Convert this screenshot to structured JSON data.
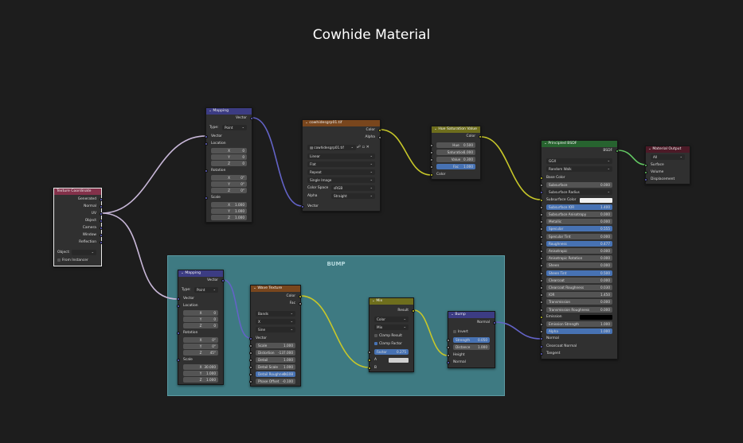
{
  "title": "Cowhide Material",
  "frame": {
    "label": "BUMP"
  },
  "texcoord": {
    "title": "Texture Coordinate",
    "outputs": [
      "Generated",
      "Normal",
      "UV",
      "Object",
      "Camera",
      "Window",
      "Reflection"
    ],
    "object_label": "Object:",
    "from_instancer": "From Instancer"
  },
  "mapping1": {
    "title": "Mapping",
    "out": "Vector",
    "type_label": "Type:",
    "type_value": "Point",
    "vector": "Vector",
    "location": "Location",
    "loc": [
      "0",
      "0",
      "0"
    ],
    "rotation": "Rotation",
    "rot": [
      "0°",
      "0°",
      "0°"
    ],
    "scale": "Scale",
    "scl": [
      "1.000",
      "1.000",
      "1.000"
    ],
    "axes": [
      "X",
      "Y",
      "Z"
    ]
  },
  "imgtex": {
    "title": "cowhidesgrp01.tif",
    "outputs": [
      "Color",
      "Alpha"
    ],
    "image_name": "cowhidesgrp01.tif",
    "interp": "Linear",
    "proj": "Flat",
    "ext": "Repeat",
    "source": "Single Image",
    "colorspace_label": "Color Space",
    "colorspace": "sRGB",
    "alpha_label": "Alpha",
    "alpha": "Straight",
    "vector": "Vector"
  },
  "hsv": {
    "title": "Hue Saturation Value",
    "out": "Color",
    "fields": [
      {
        "label": "Hue",
        "value": "0.500"
      },
      {
        "label": "Saturation",
        "value": "1.000"
      },
      {
        "label": "Value",
        "value": "0.300"
      },
      {
        "label": "Fac",
        "value": "1.000"
      }
    ],
    "color_in": "Color"
  },
  "principled": {
    "title": "Principled BSDF",
    "out": "BSDF",
    "dist": "GGX",
    "sss_method": "Random Walk",
    "rows": [
      {
        "label": "Base Color",
        "value": "",
        "kind": "text",
        "sock": "yellow"
      },
      {
        "label": "Subsurface",
        "value": "0.000",
        "kind": "field",
        "sock": "gray"
      },
      {
        "label": "Subsurface Radius",
        "value": "",
        "kind": "dd",
        "sock": "purple"
      },
      {
        "label": "Subsurface Color",
        "value": "",
        "kind": "color",
        "sock": "yellow"
      },
      {
        "label": "Subsurface IOR",
        "value": "1.400",
        "kind": "blue",
        "sock": "gray"
      },
      {
        "label": "Subsurface Anisotropy",
        "value": "0.000",
        "kind": "field",
        "sock": "gray"
      },
      {
        "label": "Metallic",
        "value": "0.000",
        "kind": "field",
        "sock": "gray"
      },
      {
        "label": "Specular",
        "value": "0.555",
        "kind": "blue",
        "sock": "gray"
      },
      {
        "label": "Specular Tint",
        "value": "0.000",
        "kind": "field",
        "sock": "gray"
      },
      {
        "label": "Roughness",
        "value": "0.477",
        "kind": "blue",
        "sock": "gray"
      },
      {
        "label": "Anisotropic",
        "value": "0.000",
        "kind": "field",
        "sock": "gray"
      },
      {
        "label": "Anisotropic Rotation",
        "value": "0.000",
        "kind": "field",
        "sock": "gray"
      },
      {
        "label": "Sheen",
        "value": "0.000",
        "kind": "field",
        "sock": "gray"
      },
      {
        "label": "Sheen Tint",
        "value": "0.500",
        "kind": "blue",
        "sock": "gray"
      },
      {
        "label": "Clearcoat",
        "value": "0.000",
        "kind": "field",
        "sock": "gray"
      },
      {
        "label": "Clearcoat Roughness",
        "value": "0.030",
        "kind": "field",
        "sock": "gray"
      },
      {
        "label": "IOR",
        "value": "1.450",
        "kind": "field",
        "sock": "gray"
      },
      {
        "label": "Transmission",
        "value": "0.000",
        "kind": "field",
        "sock": "gray"
      },
      {
        "label": "Transmission Roughness",
        "value": "0.000",
        "kind": "field",
        "sock": "gray"
      },
      {
        "label": "Emission",
        "value": "",
        "kind": "black",
        "sock": "yellow"
      },
      {
        "label": "Emission Strength",
        "value": "1.000",
        "kind": "field",
        "sock": "gray"
      },
      {
        "label": "Alpha",
        "value": "1.000",
        "kind": "blue",
        "sock": "gray"
      },
      {
        "label": "Normal",
        "value": "",
        "kind": "text",
        "sock": "purple"
      },
      {
        "label": "Clearcoat Normal",
        "value": "",
        "kind": "text",
        "sock": "purple"
      },
      {
        "label": "Tangent",
        "value": "",
        "kind": "text",
        "sock": "purple"
      }
    ]
  },
  "output": {
    "title": "Material Output",
    "target": "All",
    "inputs": [
      "Surface",
      "Volume",
      "Displacement"
    ]
  },
  "mapping2": {
    "title": "Mapping",
    "out": "Vector",
    "type_label": "Type:",
    "type_value": "Point",
    "vector": "Vector",
    "location": "Location",
    "loc": [
      "0",
      "0",
      "0"
    ],
    "rotation": "Rotation",
    "rot": [
      "0°",
      "0°",
      "45°"
    ],
    "scale": "Scale",
    "scl": [
      "30.000",
      "1.000",
      "1.000"
    ],
    "axes": [
      "X",
      "Y",
      "Z"
    ]
  },
  "wave": {
    "title": "Wave Texture",
    "outputs": [
      "Color",
      "Fac"
    ],
    "wave_type": "Bands",
    "direction": "X",
    "profile": "Sine",
    "vector": "Vector",
    "fields": [
      {
        "label": "Scale",
        "value": "1.000"
      },
      {
        "label": "Distortion",
        "value": "-137.000"
      },
      {
        "label": "Detail",
        "value": "1.000"
      },
      {
        "label": "Detail Scale",
        "value": "1.000"
      },
      {
        "label": "Detail Roughness",
        "value": "0.108"
      },
      {
        "label": "Phase Offset",
        "value": "-0.100"
      }
    ]
  },
  "mix": {
    "title": "Mix",
    "out": "Result",
    "data_type": "Color",
    "blend": "Mix",
    "clamp_result": "Clamp Result",
    "clamp_factor": "Clamp Factor",
    "factor_label": "Factor",
    "factor": "0.275",
    "a": "A",
    "b": "B"
  },
  "bump": {
    "title": "Bump",
    "out": "Normal",
    "invert": "Invert",
    "fields": [
      {
        "label": "Strength",
        "value": "0.050"
      },
      {
        "label": "Distance",
        "value": "1.000"
      }
    ],
    "inputs": [
      "Height",
      "Normal"
    ]
  },
  "colors": {
    "socket_vector": "#6363c7",
    "socket_color": "#c7c729",
    "socket_float": "#a1a1a1",
    "socket_shader": "#63c763",
    "header_vector": "#3c3c83",
    "header_texture": "#79461d",
    "header_color": "#6e6e1d",
    "header_shader": "#27632f",
    "header_output": "#4d1a27",
    "header_input": "#83314a",
    "frame": "#3e7a82"
  }
}
